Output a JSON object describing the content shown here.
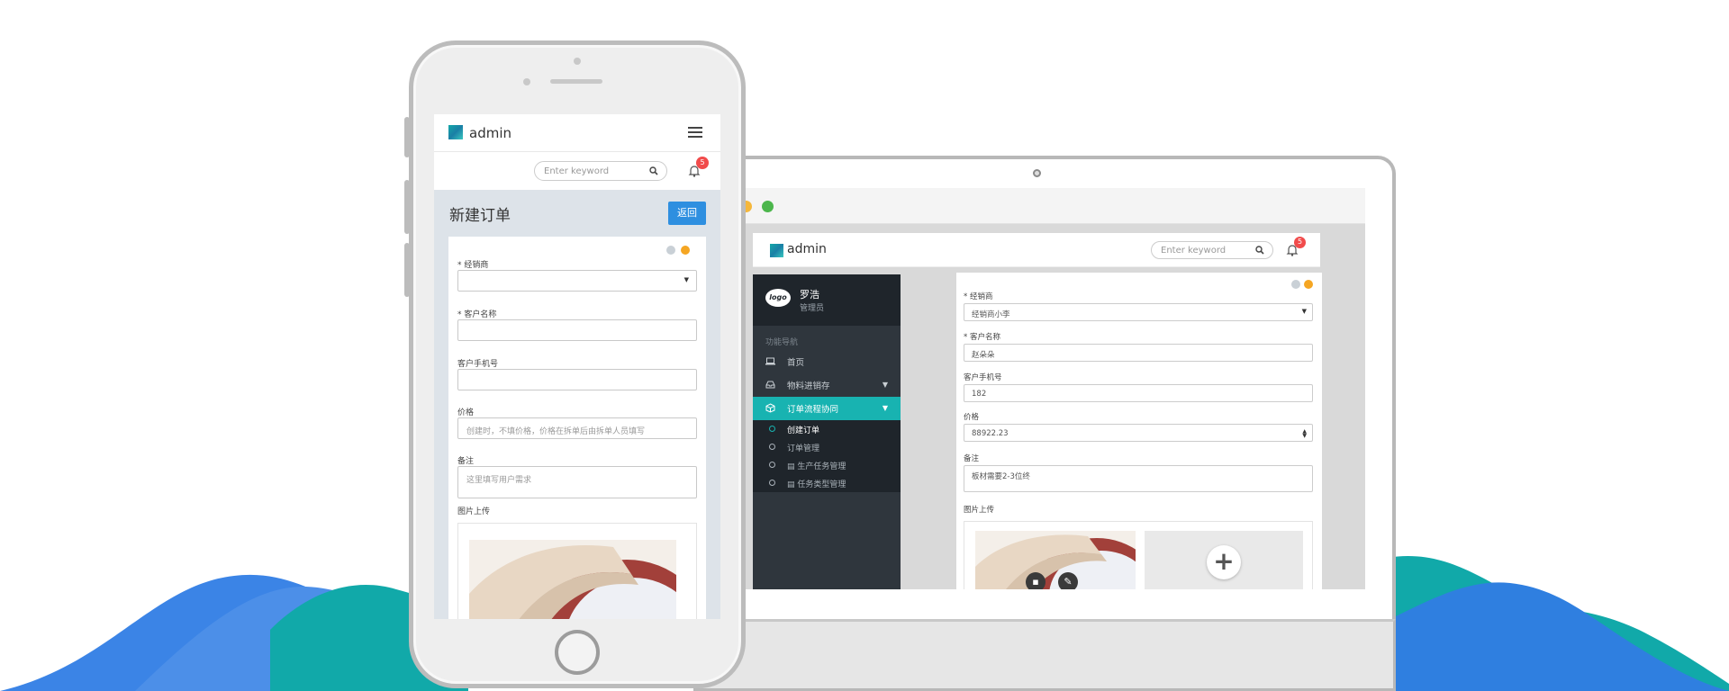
{
  "phone": {
    "brand": "admin",
    "search_placeholder": "Enter keyword",
    "notification_count": "5",
    "page_title": "新建订单",
    "back_button": "返回",
    "fields": [
      {
        "label": "* 经销商",
        "value": ""
      },
      {
        "label": "* 客户名称",
        "value": ""
      },
      {
        "label": "客户手机号",
        "value": ""
      },
      {
        "label": "价格",
        "value": "创建时，不填价格，价格在拆单后由拆单人员填写"
      },
      {
        "label": "备注",
        "value": "这里填写用户需求"
      }
    ],
    "upload_label": "图片上传"
  },
  "laptop": {
    "brand": "admin",
    "search_placeholder": "Enter keyword",
    "notification_count": "5",
    "user": {
      "logo_text": "logo",
      "name": "罗浩",
      "role": "管理员"
    },
    "nav_caption": "功能导航",
    "nav_items": [
      {
        "label": "首页",
        "icon": "laptop-icon",
        "has_caret": false,
        "active": false
      },
      {
        "label": "物料进销存",
        "icon": "inbox-icon",
        "has_caret": true,
        "active": false
      },
      {
        "label": "订单流程协同",
        "icon": "cube-icon",
        "has_caret": true,
        "active": true
      }
    ],
    "sub_items": [
      {
        "label": "创建订单",
        "active": true,
        "doc_icon": false
      },
      {
        "label": "订单管理",
        "active": false,
        "doc_icon": false
      },
      {
        "label": "生产任务管理",
        "active": false,
        "doc_icon": true
      },
      {
        "label": "任务类型管理",
        "active": false,
        "doc_icon": true
      }
    ],
    "fields": [
      {
        "label": "* 经销商",
        "value": "经销商小李"
      },
      {
        "label": "* 客户名称",
        "value": "赵朵朵"
      },
      {
        "label": "客户手机号",
        "value": "182"
      },
      {
        "label": "价格",
        "value": "88922.23"
      },
      {
        "label": "备注",
        "value": "板材需要2-3位终"
      }
    ],
    "upload_label": "图片上传"
  },
  "colors": {
    "accent_teal": "#18b3b1",
    "sidebar_bg": "#2f363d",
    "button_blue": "#2e8fe0",
    "badge_red": "#f14b4b",
    "wave_blue": "#2f7fe0",
    "wave_teal": "#11a9a9"
  }
}
